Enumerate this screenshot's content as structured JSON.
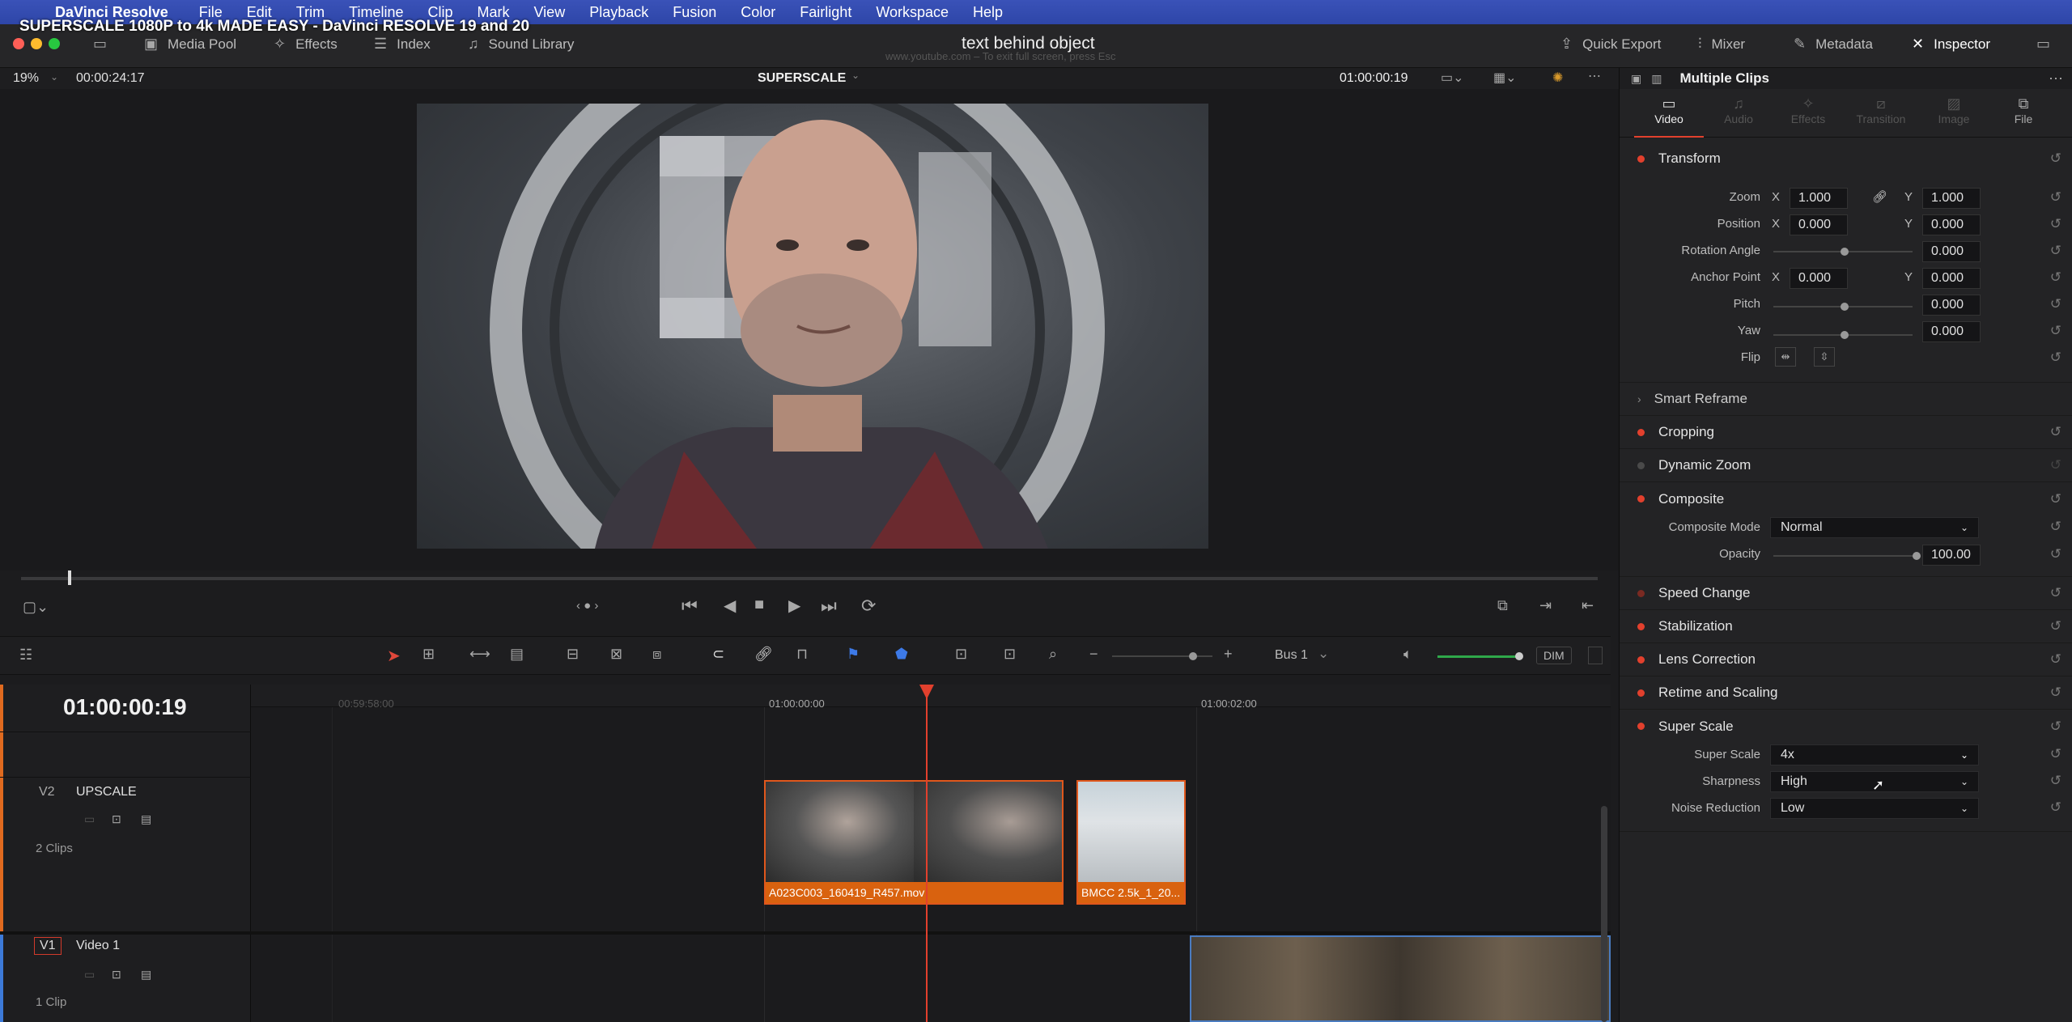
{
  "menubar": {
    "app_name": "DaVinci Resolve",
    "items": [
      "File",
      "Edit",
      "Trim",
      "Timeline",
      "Clip",
      "Mark",
      "View",
      "Playback",
      "Fusion",
      "Color",
      "Fairlight",
      "Workspace",
      "Help"
    ]
  },
  "overlay_title": "SUPERSCALE 1080P to 4k MADE EASY - DaVinci RESOLVE 19 and 20",
  "toolbar": {
    "media_pool": "Media Pool",
    "effects": "Effects",
    "index": "Index",
    "sound_library": "Sound Library",
    "project_title": "text behind object",
    "esc_hint": "www.youtube.com – To exit full screen, press  Esc",
    "quick_export": "Quick Export",
    "mixer": "Mixer",
    "metadata": "Metadata",
    "inspector": "Inspector"
  },
  "viewer": {
    "zoom": "19%",
    "source_tc": "00:00:24:17",
    "timeline_name": "SUPERSCALE",
    "record_tc": "01:00:00:19"
  },
  "timeline_toolbar": {
    "bus": "Bus 1",
    "dim": "DIM"
  },
  "timeline": {
    "timecode": "01:00:00:19",
    "ruler": [
      "00:59:58:00",
      "01:00:00:00",
      "01:00:02:00"
    ],
    "tracks": [
      {
        "id": "V2",
        "name": "UPSCALE",
        "clips_count": "2 Clips"
      },
      {
        "id": "V1",
        "name": "Video 1",
        "clips_count": "1 Clip"
      }
    ],
    "clips": {
      "clip1": "A023C003_160419_R457.mov",
      "clip2": "BMCC 2.5k_1_20..."
    }
  },
  "inspector": {
    "header": "Multiple Clips",
    "tabs": [
      "Video",
      "Audio",
      "Effects",
      "Transition",
      "Image",
      "File"
    ],
    "transform": {
      "title": "Transform",
      "zoom_label": "Zoom",
      "zoom_x": "1.000",
      "zoom_y": "1.000",
      "position_label": "Position",
      "position_x": "0.000",
      "position_y": "0.000",
      "rotation_label": "Rotation Angle",
      "rotation": "0.000",
      "anchor_label": "Anchor Point",
      "anchor_x": "0.000",
      "anchor_y": "0.000",
      "pitch_label": "Pitch",
      "pitch": "0.000",
      "yaw_label": "Yaw",
      "yaw": "0.000",
      "flip_label": "Flip",
      "x": "X",
      "y": "Y"
    },
    "smart_reframe": "Smart Reframe",
    "cropping": "Cropping",
    "dynamic_zoom": "Dynamic Zoom",
    "composite": {
      "title": "Composite",
      "mode_label": "Composite Mode",
      "mode": "Normal",
      "opacity_label": "Opacity",
      "opacity": "100.00"
    },
    "speed_change": "Speed Change",
    "stabilization": "Stabilization",
    "lens_correction": "Lens Correction",
    "retime_scaling": "Retime and Scaling",
    "super_scale": {
      "title": "Super Scale",
      "scale_label": "Super Scale",
      "scale": "4x",
      "sharpness_label": "Sharpness",
      "sharpness": "High",
      "noise_label": "Noise Reduction",
      "noise": "Low"
    }
  }
}
